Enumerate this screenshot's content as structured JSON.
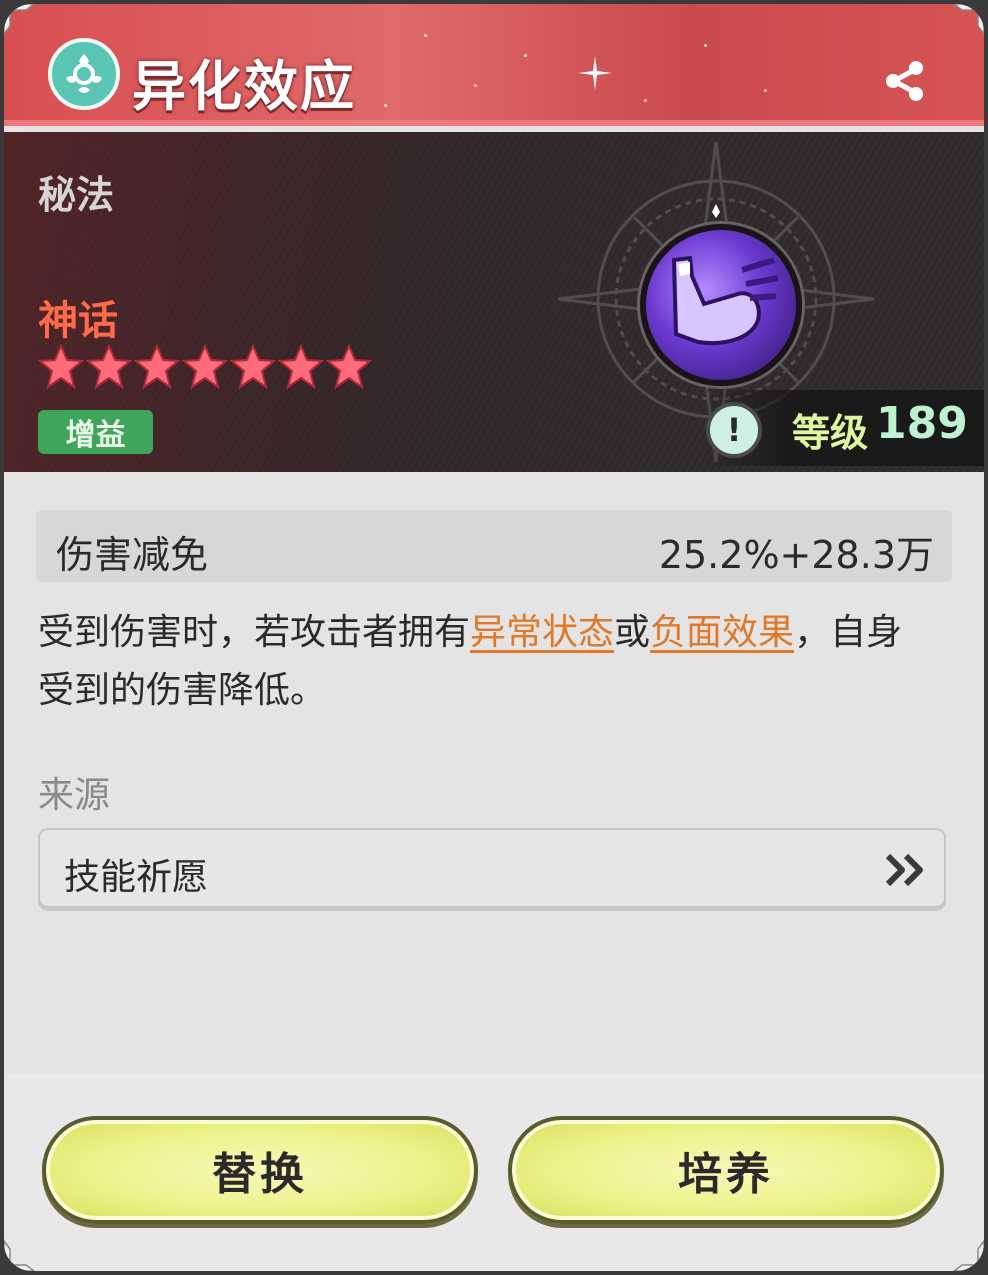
{
  "header": {
    "title": "异化效应",
    "title_icon": "emblem-icon",
    "share_icon": "share-icon"
  },
  "hero": {
    "category": "秘法",
    "rarity": "神话",
    "rarity_color": "#ff6a4a",
    "stars": 7,
    "tag": "增益",
    "level_label": "等级",
    "level_value": "189",
    "skill_icon": "flexed-arm-icon"
  },
  "stat": {
    "name": "伤害减免",
    "value": "25.2%+28.3万"
  },
  "description": {
    "part1": "受到伤害时，若攻击者拥有",
    "keyword1": "异常状态",
    "part2": "或",
    "keyword2": "负面效果",
    "part3": "，自身受到的伤害降低。"
  },
  "source": {
    "label": "来源",
    "item": "技能祈愿"
  },
  "buttons": {
    "replace": "替换",
    "train": "培养"
  },
  "colors": {
    "header": "#d84f52",
    "tag": "#3ea55a",
    "keyword": "#e07a2a",
    "button": "#eef28c"
  }
}
